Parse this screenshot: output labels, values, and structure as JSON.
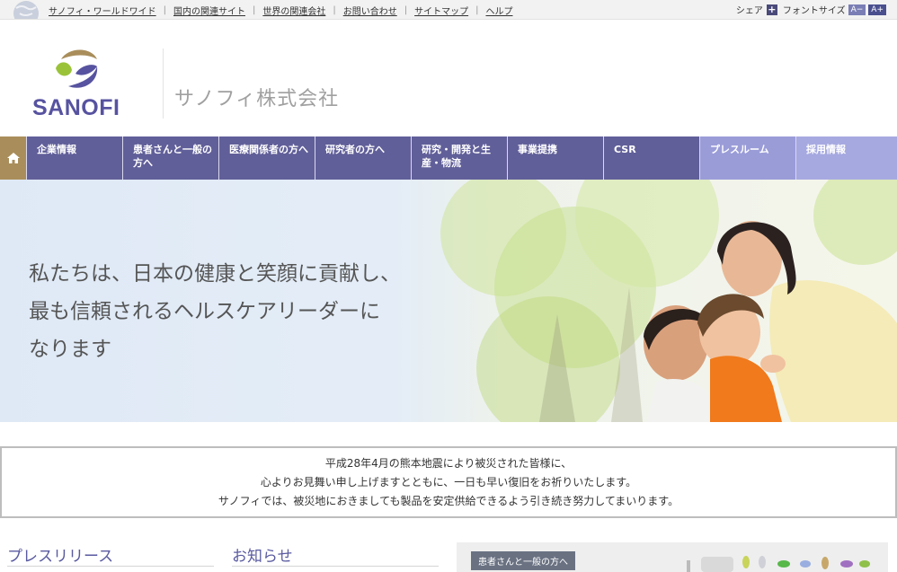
{
  "utility_bar": {
    "links": [
      "サノフィ・ワールドワイド",
      "国内の関連サイト",
      "世界の関連会社",
      "お問い合わせ",
      "サイトマップ",
      "ヘルプ"
    ],
    "share_label": "シェア",
    "font_size_label": "フォントサイズ",
    "font_small": "A−",
    "font_large": "A+"
  },
  "header": {
    "logo_text": "SANOFI",
    "company_name": "サノフィ株式会社"
  },
  "nav": {
    "items": [
      {
        "label": "企業情報"
      },
      {
        "label": "患者さんと一般の方へ"
      },
      {
        "label": "医療関係者の方へ"
      },
      {
        "label": "研究者の方へ"
      },
      {
        "label": "研究・開発と生産・物流"
      },
      {
        "label": "事業提携"
      },
      {
        "label": "CSR"
      },
      {
        "label": "プレスルーム"
      },
      {
        "label": "採用情報"
      }
    ]
  },
  "hero": {
    "line1": "私たちは、日本の健康と笑顔に貢献し、",
    "line2": "最も信頼されるヘルスケアリーダーに",
    "line3": "なります"
  },
  "notice": {
    "line1": "平成28年4月の熊本地震により被災された皆様に、",
    "line2": "心よりお見舞い申し上げますとともに、一日も早い復旧をお祈りいたします。",
    "line3": "サノフィでは、被災地におきましても製品を安定供給できるよう引き続き努力してまいります。"
  },
  "sections": {
    "press_release": "プレスリリース",
    "news": "お知らせ",
    "panel_tag": "患者さんと一般の方へ"
  },
  "colors": {
    "brand_purple": "#5753a0",
    "nav_dark": "#615f99",
    "nav_light": "#9a9cd8",
    "home_gold": "#a98e5b"
  }
}
